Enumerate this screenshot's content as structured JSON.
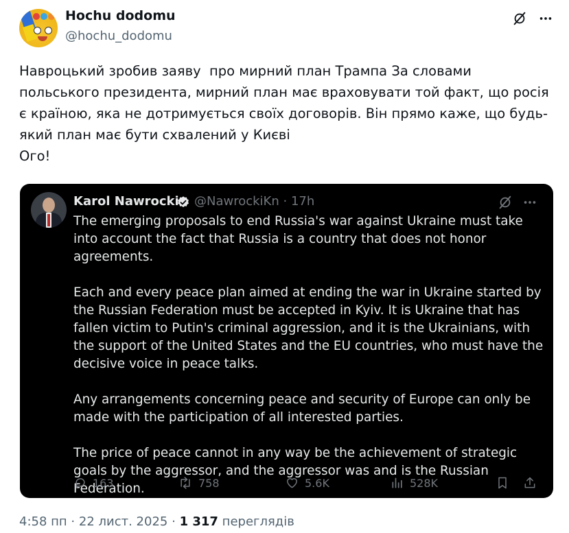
{
  "post": {
    "author_name": "Hochu dodomu",
    "author_handle": "@hochu_dodomu",
    "text": "Навроцький зробив заяву  про мирний план Трампа За словами польського президента, мирний план має враховувати той факт, що росія є країною, яка не дотримується своїх договорів. Він прямо каже, що будь-який план має бути схвалений у Києві\nОго!",
    "time": "4:58 пп",
    "date": "22 лист. 2025",
    "separator": "·",
    "views_count": "1 317",
    "views_label": "переглядів"
  },
  "quote": {
    "author_name": "Karol Nawrocki",
    "author_handle": "@NawrockiKn",
    "age": "· 17h",
    "paragraphs": [
      "The emerging proposals to end Russia's war against Ukraine must take into account the fact that Russia is a country that does not honor agreements.",
      "Each and every peace plan aimed at ending the war in Ukraine started by the Russian Federation must be accepted in Kyiv. It is Ukraine that has fallen victim to Putin's criminal aggression, and it is the Ukrainians, with the support of the United States and the EU countries, who must have the decisive voice in peace talks.",
      "Any arrangements concerning peace and security of Europe can only be made with the participation of all interested parties.",
      "The price of peace cannot in any way be the achievement of strategic goals by the aggressor, and the aggressor was and is the Russian Federation."
    ],
    "replies": "163",
    "reposts": "758",
    "likes": "5.6K",
    "views": "528K"
  },
  "icons": {
    "verified": "verified-badge-icon",
    "grok": "grok-icon",
    "more": "more-icon",
    "reply": "reply-icon",
    "repost": "repost-icon",
    "like": "like-icon",
    "views": "views-icon",
    "bookmark": "bookmark-icon",
    "share": "share-icon"
  },
  "colors": {
    "verified_blue": "#1d9bf0",
    "muted_dark": "#71767b",
    "muted_light": "#536471"
  }
}
